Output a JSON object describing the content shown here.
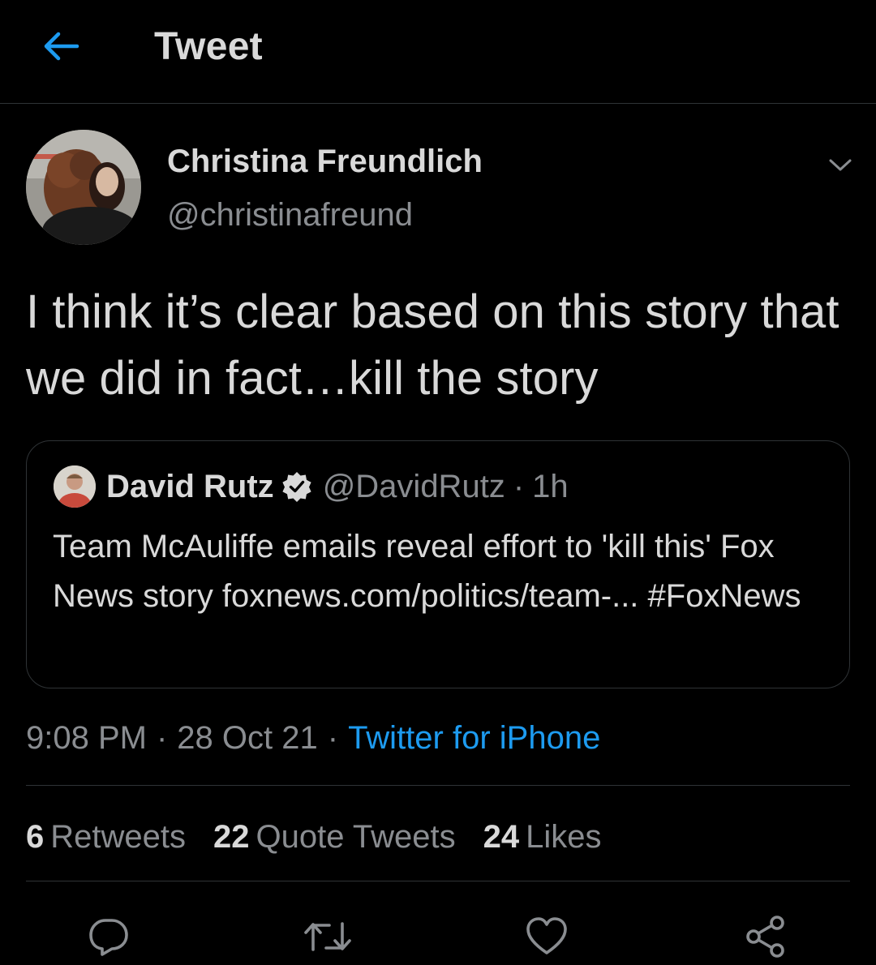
{
  "header": {
    "title": "Tweet"
  },
  "tweet": {
    "author_name": "Christina Freundlich",
    "author_handle": "@christinafreund",
    "text": "I think it’s clear based on this story that we did in fact…kill the story",
    "time": "9:08 PM",
    "date": "28 Oct 21",
    "separator": "·",
    "source": "Twitter for iPhone"
  },
  "quoted": {
    "name": "David Rutz",
    "handle": "@DavidRutz",
    "separator": "·",
    "age": "1h",
    "text": "Team McAuliffe emails reveal effort to 'kill this' Fox News story foxnews.com/politics/team-... #FoxNews"
  },
  "stats": {
    "retweets_count": "6",
    "retweets_label": "Retweets",
    "quotes_count": "22",
    "quotes_label": "Quote Tweets",
    "likes_count": "24",
    "likes_label": "Likes"
  },
  "icons": {
    "back": "arrow-left-icon",
    "more": "chevron-down-icon",
    "verified": "verified-badge-icon",
    "reply": "reply-icon",
    "retweet": "retweet-icon",
    "like": "heart-icon",
    "share": "share-icon"
  },
  "colors": {
    "background": "#000000",
    "text": "#d9d9d9",
    "secondary": "#8a8d91",
    "accent": "#1d9bf0",
    "border": "#2f3336"
  }
}
